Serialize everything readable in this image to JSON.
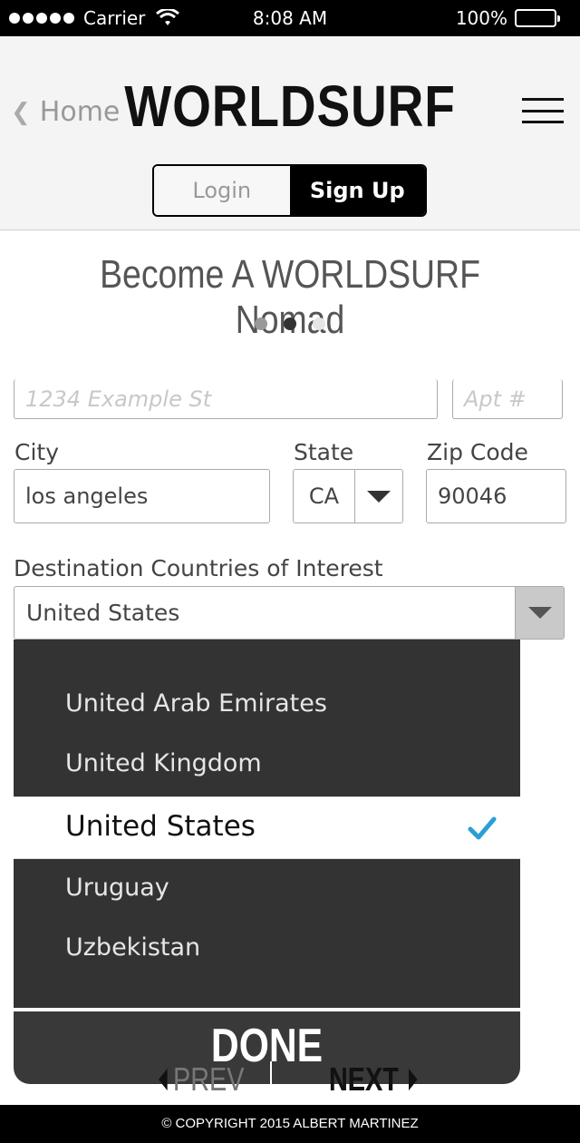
{
  "status_bar": {
    "carrier": "Carrier",
    "time": "8:08 AM",
    "battery": "100%"
  },
  "header": {
    "back_label": "Home",
    "logo_text": "WORLDSURF",
    "tabs": [
      {
        "label": "Login",
        "active": false
      },
      {
        "label": "Sign Up",
        "active": true
      }
    ]
  },
  "page": {
    "title": "Become A WORLDSURF Nomad",
    "step_dots": 3,
    "active_step": 2
  },
  "form": {
    "street_placeholder": "1234 Example St",
    "apt_placeholder": "Apt #",
    "city_label": "City",
    "city_value": "los angeles",
    "state_label": "State",
    "state_value": "CA",
    "zip_label": "Zip Code",
    "zip_value": "90046",
    "countries_label": "Destination Countries of Interest",
    "countries_value": "United States"
  },
  "picker": {
    "options": [
      "United Arab Emirates",
      "United Kingdom",
      "United States",
      "Uruguay",
      "Uzbekistan"
    ],
    "selected": "United States",
    "done_label": "DONE"
  },
  "nav": {
    "prev_label": "PREV",
    "next_label": "NEXT"
  },
  "footer": {
    "copyright": "© COPYRIGHT 2015 ALBERT MARTINEZ"
  },
  "colors": {
    "accent_check": "#2a9fd6",
    "picker_bg": "#333333",
    "header_bg": "#f4f4f4"
  }
}
